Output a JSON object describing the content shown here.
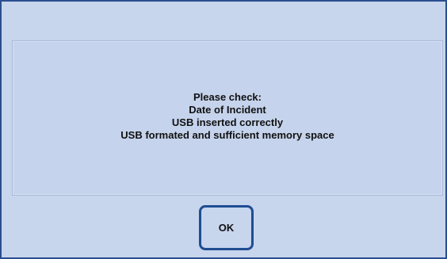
{
  "dialog": {
    "message_lines": [
      "Please check:",
      "Date of Incident",
      "USB inserted correctly",
      "USB formated and sufficient memory space"
    ],
    "ok_label": "OK"
  },
  "colors": {
    "background": "#c7d5ed",
    "border": "#2a4f8f",
    "button_border": "#1f4d91"
  }
}
